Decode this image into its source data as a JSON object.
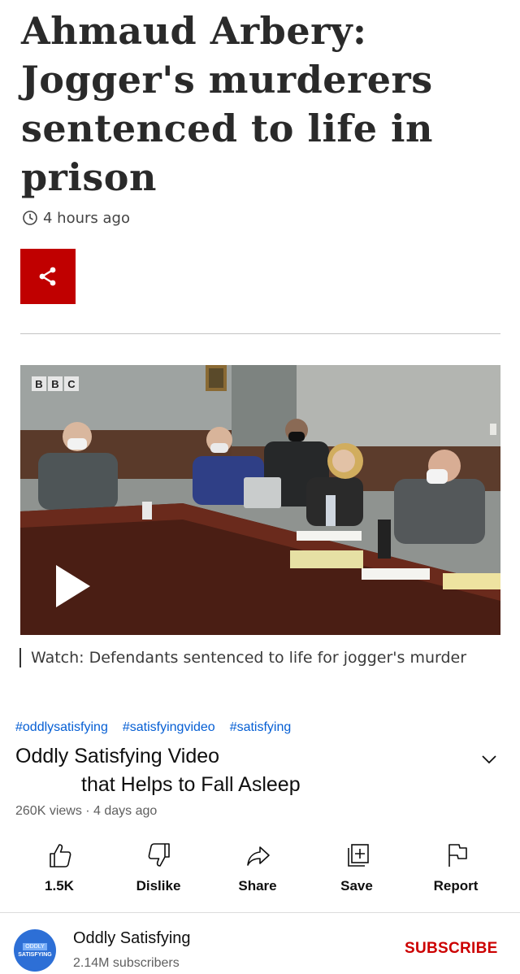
{
  "article": {
    "headline_lines": [
      "Ahmaud Arbery:",
      "Jogger's murderers",
      "sentenced to life in",
      "prison"
    ],
    "timestamp": "4 hours ago",
    "video_caption": "Watch: Defendants sentenced to life for jogger's murder",
    "bbc_logo_letters": [
      "B",
      "B",
      "C"
    ]
  },
  "youtube": {
    "hashtags": [
      "#oddlysatisfying",
      "#satisfyingvideo",
      "#satisfying"
    ],
    "title_line1": "Oddly Satisfying Video",
    "title_line2": "that Helps to Fall Asleep",
    "meta": "260K views · 4 days ago",
    "actions": [
      {
        "label": "1.5K",
        "icon": "thumb-up-icon"
      },
      {
        "label": "Dislike",
        "icon": "thumb-down-icon"
      },
      {
        "label": "Share",
        "icon": "share-arrow-icon"
      },
      {
        "label": "Save",
        "icon": "playlist-add-icon"
      },
      {
        "label": "Report",
        "icon": "flag-icon"
      }
    ],
    "channel": {
      "name": "Oddly Satisfying",
      "subscribers": "2.14M subscribers",
      "avatar_line1": "ODDLY",
      "avatar_line2": "SATISFYING",
      "subscribe_label": "SUBSCRIBE"
    }
  },
  "colors": {
    "bbc_red": "#c00000",
    "link_blue": "#065fd4",
    "subscribe_red": "#cc0000"
  }
}
